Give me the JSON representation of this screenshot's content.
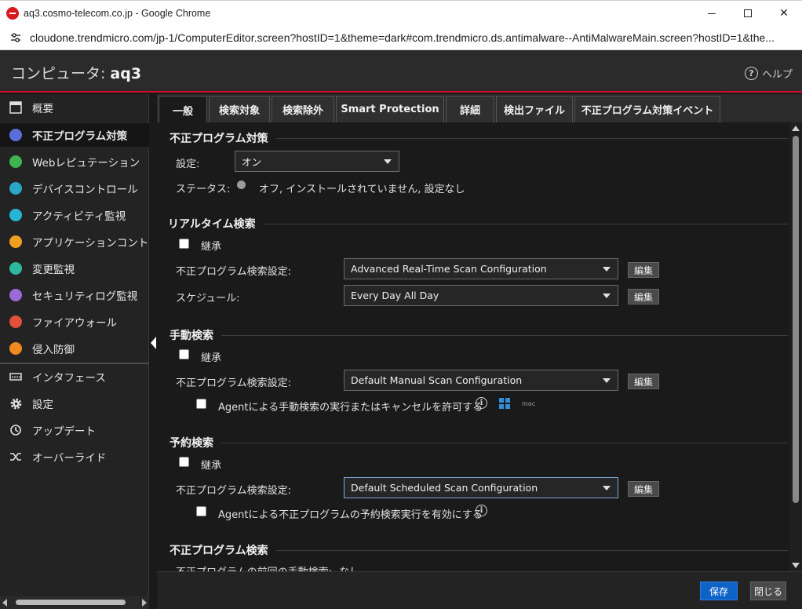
{
  "browser": {
    "window_title": "aq3.cosmo-telecom.co.jp - Google Chrome",
    "url": "cloudone.trendmicro.com/jp-1/ComputerEditor.screen?hostID=1&theme=dark#com.trendmicro.ds.antimalware--AntiMalwareMain.screen?hostID=1&the..."
  },
  "header": {
    "title_prefix": "コンピュータ:",
    "computer_name": "aq3",
    "help_label": "ヘルプ"
  },
  "sidebar": {
    "items": [
      {
        "label": "概要",
        "icon": "overview-icon",
        "color": "#e0e0e0"
      },
      {
        "label": "不正プログラム対策",
        "icon": "anti-malware-icon",
        "color": "#5b6fd8"
      },
      {
        "label": "Webレピュテーション",
        "icon": "web-reputation-icon",
        "color": "#3fb34f"
      },
      {
        "label": "デバイスコントロール",
        "icon": "device-control-icon",
        "color": "#2aa7c9"
      },
      {
        "label": "アクティビティ監視",
        "icon": "activity-monitoring-icon",
        "color": "#27b5d6"
      },
      {
        "label": "アプリケーションコントロール",
        "icon": "application-control-icon",
        "color": "#f0a020"
      },
      {
        "label": "変更監視",
        "icon": "integrity-monitoring-icon",
        "color": "#2fb8a0"
      },
      {
        "label": "セキュリティログ監視",
        "icon": "log-inspection-icon",
        "color": "#9b6ad8"
      },
      {
        "label": "ファイアウォール",
        "icon": "firewall-icon",
        "color": "#e0503a"
      },
      {
        "label": "侵入防御",
        "icon": "intrusion-prevention-icon",
        "color": "#f08a20"
      },
      {
        "label": "インタフェース",
        "icon": "interfaces-icon",
        "color": "#e0e0e0"
      },
      {
        "label": "設定",
        "icon": "gear-icon",
        "color": "#e0e0e0"
      },
      {
        "label": "アップデート",
        "icon": "updates-icon",
        "color": "#e0e0e0"
      },
      {
        "label": "オーバーライド",
        "icon": "overrides-icon",
        "color": "#e0e0e0"
      }
    ]
  },
  "tabs": [
    {
      "label": "一般"
    },
    {
      "label": "検索対象"
    },
    {
      "label": "検索除外"
    },
    {
      "label": "Smart Protection"
    },
    {
      "label": "詳細"
    },
    {
      "label": "検出ファイル"
    },
    {
      "label": "不正プログラム対策イベント"
    }
  ],
  "antimalware": {
    "heading": "不正プログラム対策",
    "setting_label": "設定:",
    "setting_value": "オン",
    "status_label": "ステータス:",
    "status_value": "オフ, インストールされていません, 設定なし"
  },
  "realtime": {
    "heading": "リアルタイム検索",
    "inherit_label": "継承",
    "config_label": "不正プログラム検索設定:",
    "config_value": "Advanced Real-Time Scan Configuration",
    "edit_label": "編集",
    "schedule_label": "スケジュール:",
    "schedule_value": "Every Day All Day",
    "schedule_edit_label": "編集"
  },
  "manual": {
    "heading": "手動検索",
    "inherit_label": "継承",
    "config_label": "不正プログラム検索設定:",
    "config_value": "Default Manual Scan Configuration",
    "edit_label": "編集",
    "allow_label": "Agentによる手動検索の実行またはキャンセルを許可する",
    "mac_label": "mac"
  },
  "scheduled": {
    "heading": "予約検索",
    "inherit_label": "継承",
    "config_label": "不正プログラム検索設定:",
    "config_value": "Default Scheduled Scan Configuration",
    "edit_label": "編集",
    "allow_label": "Agentによる不正プログラムの予約検索実行を有効にする"
  },
  "malware_scan": {
    "heading": "不正プログラム検索",
    "last_manual_label": "不正プログラムの前回の手動検索:",
    "last_manual_value": "なし"
  },
  "footer": {
    "save_label": "保存",
    "close_label": "閉じる"
  }
}
